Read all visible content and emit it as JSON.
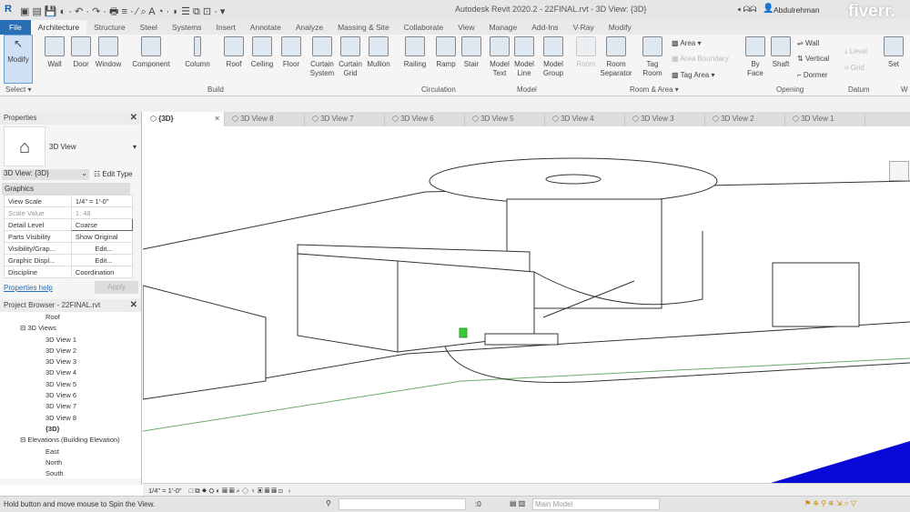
{
  "title": "Autodesk Revit 2020.2 - 22FINAL.rvt - 3D View: {3D}",
  "user": "Abdulrehman",
  "watermark": "fiverr.",
  "tabs": [
    "File",
    "Architecture",
    "Structure",
    "Steel",
    "Systems",
    "Insert",
    "Annotate",
    "Analyze",
    "Massing & Site",
    "Collaborate",
    "View",
    "Manage",
    "Add-Ins",
    "V-Ray",
    "Modify"
  ],
  "tools": {
    "modify": "Modify",
    "wall": "Wall",
    "door": "Door",
    "window": "Window",
    "component": "Component",
    "column": "Column",
    "roof": "Roof",
    "ceiling": "Ceiling",
    "floor": "Floor",
    "curtain_system": "Curtain System",
    "curtain_grid": "Curtain Grid",
    "mullion": "Mullion",
    "railing": "Railing",
    "ramp": "Ramp",
    "stair": "Stair",
    "model_text": "Model Text",
    "model_line": "Model Line",
    "model_group": "Model Group",
    "room": "Room",
    "room_separator": "Room Separator",
    "tag_room": "Tag Room",
    "area": "Area",
    "area_boundary": "Area Boundary",
    "tag_area": "Tag Area",
    "by_face": "By Face",
    "shaft": "Shaft",
    "wall_op": "Wall",
    "vertical": "Vertical",
    "dormer": "Dormer",
    "level": "Level",
    "grid": "Grid",
    "set": "Set"
  },
  "panels": {
    "select": "Select ▾",
    "build": "Build",
    "circulation": "Circulation",
    "model": "Model",
    "room_area": "Room & Area ▾",
    "opening": "Opening",
    "datum": "Datum",
    "work": "W"
  },
  "properties": {
    "title": "Properties",
    "type": "3D View",
    "selector": "3D View: {3D}",
    "edit_type": "Edit Type",
    "section": "Graphics",
    "rows": [
      [
        "View Scale",
        "1/4\" = 1'-0\""
      ],
      [
        "Scale Value",
        "1: 48"
      ],
      [
        "Detail Level",
        "Coarse"
      ],
      [
        "Parts Visibility",
        "Show Original"
      ],
      [
        "Visibility/Grap...",
        "Edit..."
      ],
      [
        "Graphic Displ...",
        "Edit..."
      ],
      [
        "Discipline",
        "Coordination"
      ]
    ],
    "help": "Properties help",
    "apply": "Apply"
  },
  "browser": {
    "title": "Project Browser - 22FINAL.rvt",
    "items": [
      "Roof",
      "3D Views",
      "3D View 1",
      "3D View 2",
      "3D View 3",
      "3D View 4",
      "3D View 5",
      "3D View 6",
      "3D View 7",
      "3D View 8",
      "{3D}",
      "Elevations (Building Elevation)",
      "East",
      "North",
      "South"
    ]
  },
  "view_tabs": [
    "{3D}",
    "3D View 8",
    "3D View 7",
    "3D View 6",
    "3D View 5",
    "3D View 4",
    "3D View 3",
    "3D View 2",
    "3D View 1"
  ],
  "view_scale": "1/4\" = 1'-0\"",
  "status": {
    "message": "Hold button and move mouse to Spin the View.",
    "workset_value": ":0",
    "model": "Main Model"
  }
}
